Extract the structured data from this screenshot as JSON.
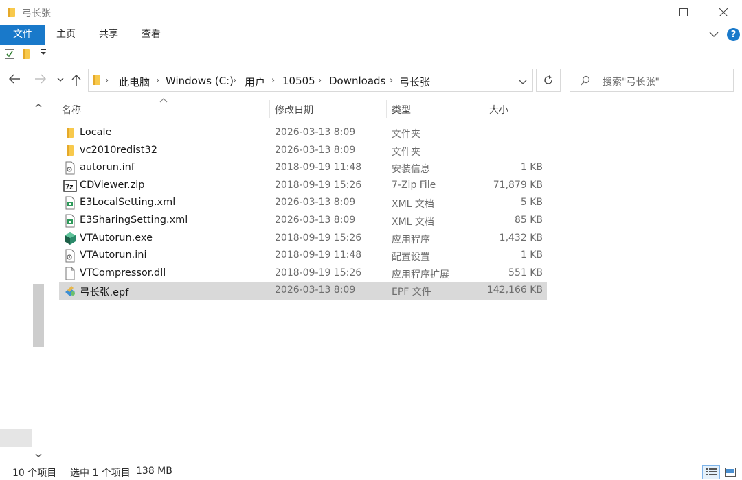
{
  "window": {
    "title": "弓长张"
  },
  "ribbon": {
    "tabs": [
      {
        "label": "文件"
      },
      {
        "label": "主页"
      },
      {
        "label": "共享"
      },
      {
        "label": "查看"
      }
    ],
    "help_label": "?"
  },
  "address": {
    "crumbs": [
      "此电脑",
      "Windows (C:)",
      "用户",
      "10505",
      "Downloads",
      "弓长张"
    ]
  },
  "search": {
    "placeholder": "搜索\"弓长张\""
  },
  "columns": {
    "name": "名称",
    "date": "修改日期",
    "type": "类型",
    "size": "大小"
  },
  "files": [
    {
      "name": "Locale",
      "date": "2026-03-13 8:09",
      "type": "文件夹",
      "size": "",
      "icon": "folder-icon"
    },
    {
      "name": "vc2010redist32",
      "date": "2026-03-13 8:09",
      "type": "文件夹",
      "size": "",
      "icon": "folder-icon"
    },
    {
      "name": "autorun.inf",
      "date": "2018-09-19 11:48",
      "type": "安装信息",
      "size": "1 KB",
      "icon": "settings-file-icon"
    },
    {
      "name": "CDViewer.zip",
      "date": "2018-09-19 15:26",
      "type": "7-Zip File",
      "size": "71,879 KB",
      "icon": "7zip-icon"
    },
    {
      "name": "E3LocalSetting.xml",
      "date": "2026-03-13 8:09",
      "type": "XML 文档",
      "size": "5 KB",
      "icon": "xml-file-icon"
    },
    {
      "name": "E3SharingSetting.xml",
      "date": "2026-03-13 8:09",
      "type": "XML 文档",
      "size": "85 KB",
      "icon": "xml-file-icon"
    },
    {
      "name": "VTAutorun.exe",
      "date": "2018-09-19 15:26",
      "type": "应用程序",
      "size": "1,432 KB",
      "icon": "exe-icon"
    },
    {
      "name": "VTAutorun.ini",
      "date": "2018-09-19 11:48",
      "type": "配置设置",
      "size": "1 KB",
      "icon": "settings-file-icon"
    },
    {
      "name": "VTCompressor.dll",
      "date": "2018-09-19 15:26",
      "type": "应用程序扩展",
      "size": "551 KB",
      "icon": "dll-file-icon"
    },
    {
      "name": "弓长张.epf",
      "date": "2026-03-13 8:09",
      "type": "EPF 文件",
      "size": "142,166 KB",
      "icon": "epf-file-icon",
      "selected": true
    }
  ],
  "status": {
    "count": "10 个项目",
    "selected": "选中 1 个项目",
    "selected_size": "138 MB"
  },
  "colors": {
    "accent": "#1979ca",
    "folder": "#f8c94c",
    "selection": "#d9d9d9"
  }
}
